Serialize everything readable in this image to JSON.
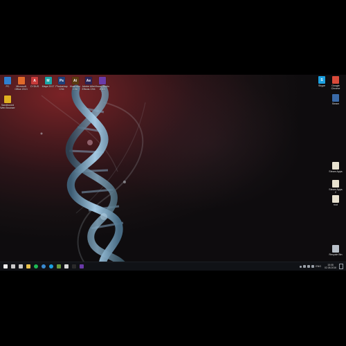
{
  "desktop": {
    "icons_top": [
      {
        "name": "this-pc-icon",
        "label": "PC",
        "color": "#2f7fd0",
        "glyph": ""
      },
      {
        "name": "office-icon",
        "label": "Microsoft Office 2013",
        "color": "#e06a2a",
        "glyph": ""
      },
      {
        "name": "autocad-icon",
        "label": "CYDUS",
        "color": "#c83a3a",
        "glyph": "A"
      },
      {
        "name": "maya-icon",
        "label": "Maya 2017",
        "color": "#1aa6a8",
        "glyph": "M"
      },
      {
        "name": "photoshop-icon",
        "label": "Photoshop CS6",
        "color": "#1f3f7a",
        "glyph": "Ps"
      },
      {
        "name": "illustrator-icon",
        "label": "Illustrator CS6",
        "color": "#5a3a10",
        "glyph": "Ai"
      },
      {
        "name": "after-effects-icon",
        "label": "Adobe After Effects CS6",
        "color": "#2c2456",
        "glyph": "Ae"
      },
      {
        "name": "visual-studio-icon",
        "label": "Visual Studio 2013",
        "color": "#6a3aa8",
        "glyph": ""
      }
    ],
    "icons_left": [
      {
        "name": "sandboxed-browser-icon",
        "label": "Sandboxed Web Browser",
        "color": "#e0b020",
        "glyph": ""
      }
    ],
    "icons_right": [
      {
        "name": "skype-icon",
        "label": "Skype",
        "color": "#1ba0e0",
        "glyph": "S"
      },
      {
        "name": "chrome-icon",
        "label": "Google Chrome",
        "color": "#d94a3a",
        "glyph": ""
      },
      {
        "name": "steam-icon",
        "label": "Steam",
        "color": "#3a6aa8",
        "glyph": ""
      },
      {
        "name": "steam-apps-icon",
        "label": "Steam Apps",
        "color": "#e8e2d0",
        "glyph": ""
      },
      {
        "name": "steam-apps-2-icon",
        "label": "Steam Apps 2",
        "color": "#e8e2d0",
        "glyph": ""
      },
      {
        "name": "rust-icon",
        "label": "rust",
        "color": "#e8e2d0",
        "glyph": ""
      },
      {
        "name": "recycle-bin-icon",
        "label": "Recycle Bin",
        "color": "#b8c0c8",
        "glyph": ""
      }
    ]
  },
  "taskbar": {
    "items": [
      {
        "name": "start-button-icon",
        "color": "#f0f0f0"
      },
      {
        "name": "search-icon",
        "color": "#c8c8c8"
      },
      {
        "name": "task-view-icon",
        "color": "#c8c8c8"
      },
      {
        "name": "file-explorer-icon",
        "color": "#e8c24a"
      },
      {
        "name": "spotify-icon",
        "color": "#1db954"
      },
      {
        "name": "chrome-taskbar-icon",
        "color": "#3a8ad0"
      },
      {
        "name": "skype-taskbar-icon",
        "color": "#1ba0e0"
      },
      {
        "name": "minecraft-icon",
        "color": "#6a9a3a"
      },
      {
        "name": "media-player-icon",
        "color": "#d8d8d8"
      },
      {
        "name": "cmd-icon",
        "color": "#2a2a2a"
      },
      {
        "name": "visual-studio-taskbar-icon",
        "color": "#6a3aa8"
      }
    ],
    "language": "ENG",
    "time": "15:08",
    "date": "02.08.2016"
  },
  "colors": {
    "wallpaper_accent": "#7a2326",
    "dna_strand": "#8fb8d8",
    "taskbar_bg": "#101216"
  }
}
